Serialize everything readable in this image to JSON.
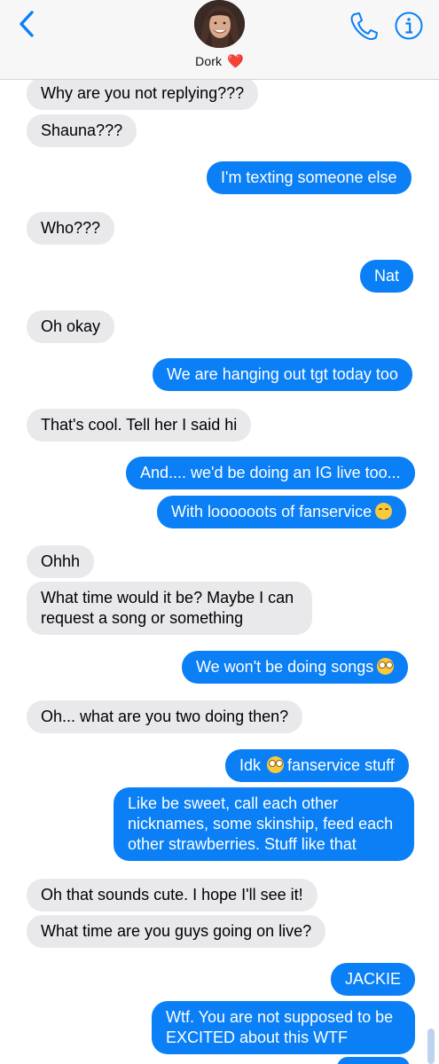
{
  "header": {
    "contact_name": "Dork",
    "contact_emoji": "❤️",
    "icons": {
      "back": "chevron-left-icon",
      "call": "phone-icon",
      "info": "info-icon"
    },
    "accent_color": "#0b7ff5"
  },
  "messages": [
    {
      "dir": "in",
      "text": "Why are you not replying???"
    },
    {
      "dir": "in",
      "text": "Shauna???"
    },
    {
      "dir": "out",
      "text": "I'm texting someone else"
    },
    {
      "dir": "in",
      "text": "Who???"
    },
    {
      "dir": "out",
      "text": "Nat"
    },
    {
      "dir": "in",
      "text": "Oh okay"
    },
    {
      "dir": "out",
      "text": "We are hanging out tgt today too"
    },
    {
      "dir": "in",
      "text": "That's cool. Tell her I said hi"
    },
    {
      "dir": "out",
      "text": "And.... we'd be doing an IG live too..."
    },
    {
      "dir": "out",
      "text": "With loooooots of fanservice",
      "emoji": "smiling-face"
    },
    {
      "dir": "in",
      "text": "Ohhh"
    },
    {
      "dir": "in",
      "text": "What time would it be? Maybe I can request a song or something"
    },
    {
      "dir": "out",
      "text": "We won't be doing songs",
      "emoji": "face-with-rolling-eyes"
    },
    {
      "dir": "in",
      "text": "Oh... what are you two doing then?"
    },
    {
      "dir": "out",
      "text_before": "Idk",
      "text_after": "fanservice stuff",
      "emoji": "face-with-rolling-eyes"
    },
    {
      "dir": "out",
      "text": "Like be sweet, call each other nicknames, some skinship, feed each other strawberries. Stuff like that"
    },
    {
      "dir": "in",
      "text": "Oh that sounds cute.  I hope I'll see it!"
    },
    {
      "dir": "in",
      "text": "What time are you guys going on live?"
    },
    {
      "dir": "out",
      "text": "JACKIE"
    },
    {
      "dir": "out",
      "text": "Wtf. You are not supposed to be EXCITED about this WTF"
    }
  ],
  "colors": {
    "incoming_bubble": "#e9e9eb",
    "outgoing_bubble": "#0b7ff5",
    "outgoing_text": "#ffffff"
  }
}
